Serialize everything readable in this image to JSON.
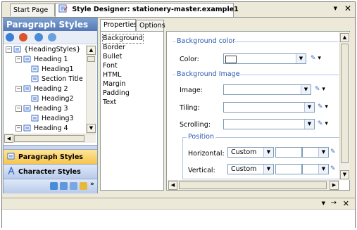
{
  "tabs": {
    "start_page": "Start Page",
    "designer": "Style Designer: stationery-master.example1",
    "close_symbol": "✕"
  },
  "left_panel": {
    "title": "Paragraph Styles",
    "tree": [
      {
        "label": "{HeadingStyles}",
        "level": 0,
        "expander": "-"
      },
      {
        "label": "Heading 1",
        "level": 1,
        "expander": "-"
      },
      {
        "label": "Heading1",
        "level": 2,
        "expander": ""
      },
      {
        "label": "Section Title",
        "level": 2,
        "expander": ""
      },
      {
        "label": "Heading 2",
        "level": 1,
        "expander": "-"
      },
      {
        "label": "Heading2",
        "level": 2,
        "expander": ""
      },
      {
        "label": "Heading 3",
        "level": 1,
        "expander": "-"
      },
      {
        "label": "Heading3",
        "level": 2,
        "expander": ""
      },
      {
        "label": "Heading 4",
        "level": 1,
        "expander": "-"
      }
    ],
    "nav_paragraph": "Paragraph Styles",
    "nav_character": "Character Styles"
  },
  "property_tabs": {
    "properties": "Properties",
    "options": "Options"
  },
  "categories": [
    "Background",
    "Border",
    "Bullet",
    "Font",
    "HTML",
    "Margin",
    "Padding",
    "Text"
  ],
  "background": {
    "color_section": "Background color",
    "color_label": "Color:",
    "image_section": "Background Image",
    "image_label": "Image:",
    "tiling_label": "Tiling:",
    "scrolling_label": "Scrolling:",
    "position_section": "Position",
    "horizontal_label": "Horizontal:",
    "horizontal_value": "Custom",
    "vertical_label": "Vertical:",
    "vertical_value": "Custom"
  },
  "bottom_panel": {
    "pin_symbol": "→",
    "close_symbol": "✕"
  }
}
